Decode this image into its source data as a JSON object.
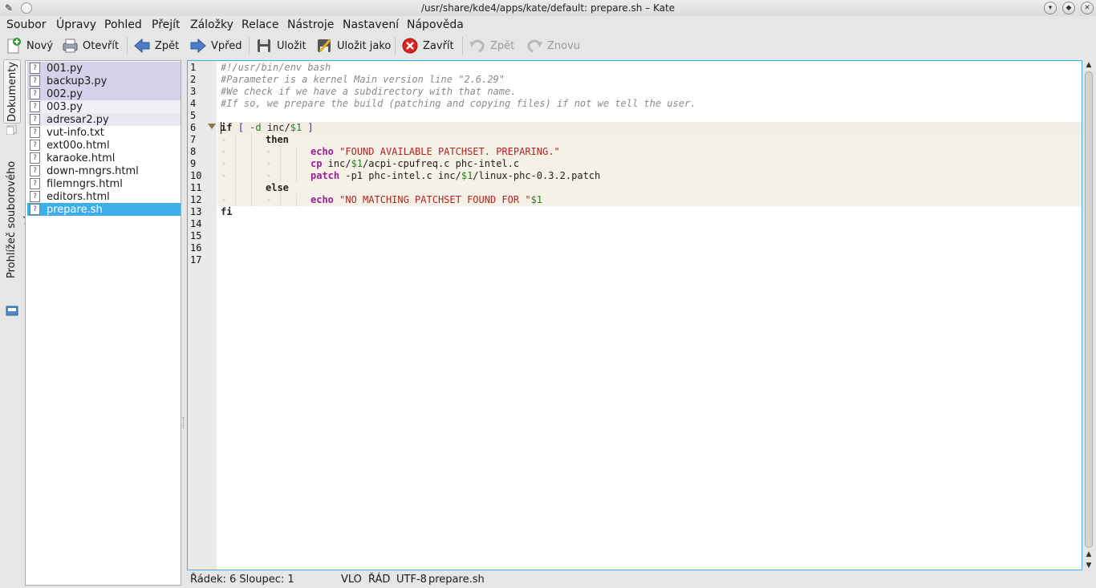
{
  "window": {
    "title": "/usr/share/kde4/apps/kate/default: prepare.sh – Kate"
  },
  "menu": [
    "Soubor",
    "Úpravy",
    "Pohled",
    "Přejít",
    "Záložky",
    "Relace",
    "Nástroje",
    "Nastavení",
    "Nápověda"
  ],
  "toolbar": {
    "new": "Nový",
    "open": "Otevřít",
    "back": "Zpět",
    "forward": "Vpřed",
    "save": "Uložit",
    "save_as": "Uložit jako",
    "close": "Zavřít",
    "undo": "Zpět",
    "redo": "Znovu"
  },
  "sidebar": {
    "tab_documents": "Dokumenty",
    "tab_browser": "Prohlížeč souborového systému"
  },
  "documents": [
    "001.py",
    "backup3.py",
    "002.py",
    "003.py",
    "adresar2.py",
    "vut-info.txt",
    "ext00o.html",
    "karaoke.html",
    "down-mngrs.html",
    "filemngrs.html",
    "editors.html",
    "prepare.sh"
  ],
  "selected_document": "prepare.sh",
  "editor": {
    "line_numbers": [
      "1",
      "2",
      "3",
      "4",
      "5",
      "6",
      "7",
      "8",
      "9",
      "10",
      "11",
      "12",
      "13",
      "14",
      "15",
      "16",
      "17"
    ],
    "lines": [
      "#!/usr/bin/env bash",
      "#Parameter is a kernel Main version line \"2.6.29\"",
      "#We check if we have a subdirectory with that name.",
      "#If so, we prepare the build (patching and copying files) if not we tell the user.",
      "",
      "if [ -d inc/$1 ]",
      "then",
      "echo \"FOUND AVAILABLE PATCHSET. PREPARING.\"",
      "cp inc/$1/acpi-cpufreq.c phc-intel.c",
      "patch -p1 phc-intel.c inc/$1/linux-phc-0.3.2.patch",
      "else",
      "echo \"NO MATCHING PATCHSET FOUND FOR \"$1",
      "fi"
    ]
  },
  "status": {
    "position": "Řádek: 6 Sloupec: 1",
    "mode": "VLO",
    "input": "ŘÁD",
    "encoding": "UTF-8",
    "filename": "prepare.sh"
  }
}
